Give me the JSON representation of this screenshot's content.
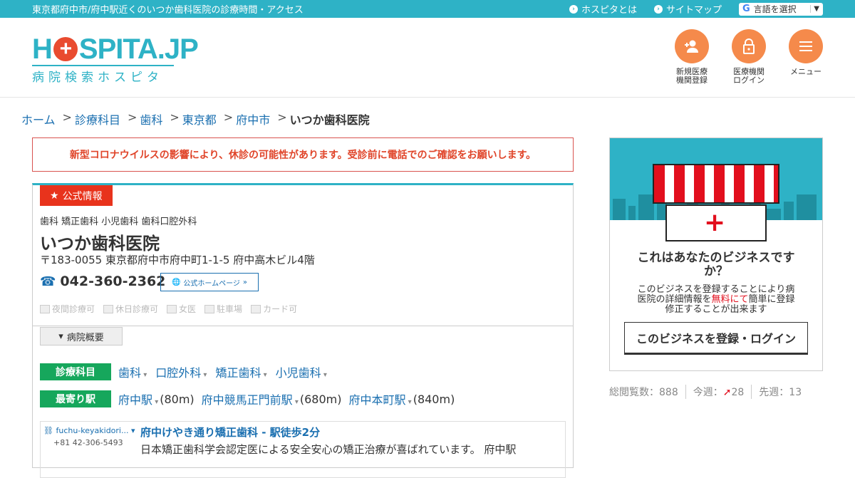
{
  "topbar": {
    "tagline": "東京都府中市/府中駅近くのいつか歯科医院の診療時間・アクセス",
    "links": [
      "ホスピタとは",
      "サイトマップ"
    ],
    "language": "言語を選択"
  },
  "logo": {
    "main_left": "H",
    "main_right": "SPITA.JP",
    "sub": "病院検索ホスピタ"
  },
  "header_buttons": [
    {
      "label1": "新規医療",
      "label2": "機関登録"
    },
    {
      "label1": "医療機関",
      "label2": "ログイン"
    },
    {
      "label1": "メニュー",
      "label2": ""
    }
  ],
  "breadcrumb": [
    "ホーム",
    "診療科目",
    "歯科",
    "東京都",
    "府中市"
  ],
  "breadcrumb_current": "いつか歯科医院",
  "notice": "新型コロナウイルスの影響により、休診の可能性があります。受診前に電話でのご確認をお願いします。",
  "clinic": {
    "badge": "公式情報",
    "categories": "歯科 矯正歯科 小児歯科 歯科口腔外科",
    "name": "いつか歯科医院",
    "address": "〒183-0055 東京都府中市府中町1-1-5 府中高木ビル4階",
    "phone": "042-360-2362",
    "homepage": "公式ホームページ",
    "features": [
      "夜間診療可",
      "休日診療可",
      "女医",
      "駐車場",
      "カード可"
    ],
    "overview": "病院概要",
    "dept_label": "診療科目",
    "depts": [
      "歯科",
      "口腔外科",
      "矯正歯科",
      "小児歯科"
    ],
    "station_label": "最寄り駅",
    "stations": [
      {
        "name": "府中駅",
        "dist": "(80m)"
      },
      {
        "name": "府中競馬正門前駅",
        "dist": "(680m)"
      },
      {
        "name": "府中本町駅",
        "dist": "(840m)"
      }
    ]
  },
  "ad": {
    "domain": "fuchu-keyakidori...",
    "tel": "+81 42-306-5493",
    "title": "府中けやき通り矯正歯科 - 駅徒歩2分",
    "body": "日本矯正歯科学会認定医による安全安心の矯正治療が喜ばれています。 府中駅"
  },
  "side": {
    "title": "これはあなたのビジネスですか？",
    "text_a": "このビジネスを登録することにより病医院の詳細情報を",
    "text_red": "無料にて",
    "text_b": "簡単に登録修正することが出来ます",
    "button": "このビジネスを登録・ログイン"
  },
  "stats": {
    "total": "総閲覧数：888",
    "today_label": "今週：",
    "today": "28",
    "last": "先週：13"
  }
}
